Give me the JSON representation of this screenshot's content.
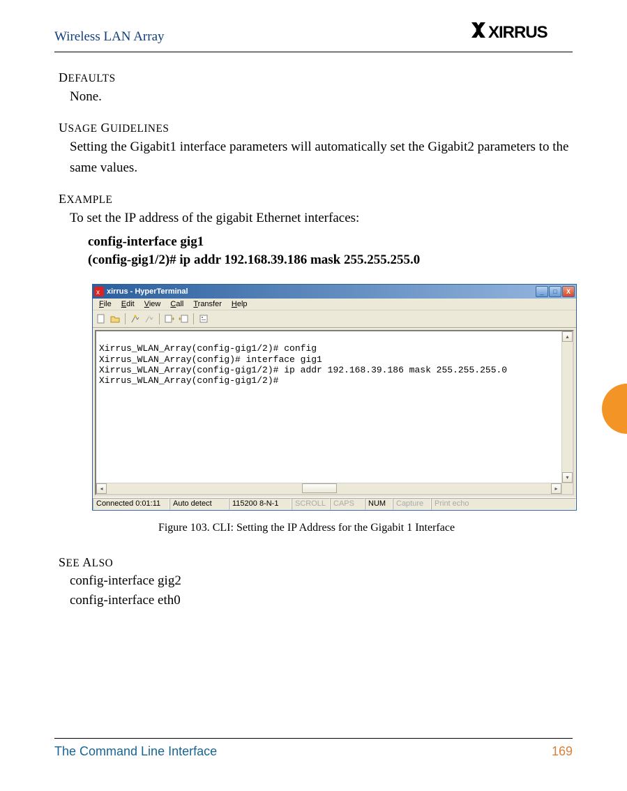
{
  "header": {
    "title": "Wireless LAN Array",
    "logo_text": "XIRRUS"
  },
  "sections": {
    "defaults": {
      "heading_prefix": "D",
      "heading_rest": "EFAULTS",
      "body": "None."
    },
    "usage": {
      "heading_prefix": "U",
      "heading_mid": "SAGE",
      "heading_sep": " G",
      "heading_rest": "UIDELINES",
      "body": "Setting the Gigabit1 interface parameters will automatically set the Gigabit2 parameters to the same values."
    },
    "example": {
      "heading_prefix": "E",
      "heading_rest": "XAMPLE",
      "body": "To set the IP address of the gigabit Ethernet interfaces:",
      "code_line1": "config-interface gig1",
      "code_line2": "(config-gig1/2)# ip addr 192.168.39.186 mask 255.255.255.0"
    },
    "seealso": {
      "heading_prefix": "S",
      "heading_mid": "EE",
      "heading_sep": " A",
      "heading_rest": "LSO",
      "line1": "config-interface gig2",
      "line2": "config-interface eth0"
    }
  },
  "figure": {
    "caption": "Figure 103. CLI: Setting the IP Address for the Gigabit 1 Interface",
    "terminal": {
      "window_title": "xirrus - HyperTerminal",
      "menu": [
        "File",
        "Edit",
        "View",
        "Call",
        "Transfer",
        "Help"
      ],
      "lines": [
        "",
        "Xirrus_WLAN_Array(config-gig1/2)# config",
        "Xirrus_WLAN_Array(config)# interface gig1",
        "Xirrus_WLAN_Array(config-gig1/2)# ip addr 192.168.39.186 mask 255.255.255.0",
        "Xirrus_WLAN_Array(config-gig1/2)#"
      ],
      "status": {
        "conn": "Connected 0:01:11",
        "detect": "Auto detect",
        "serial": "115200 8-N-1",
        "scroll": "SCROLL",
        "caps": "CAPS",
        "num": "NUM",
        "capture": "Capture",
        "echo": "Print echo"
      }
    }
  },
  "footer": {
    "section": "The Command Line Interface",
    "page": "169"
  }
}
